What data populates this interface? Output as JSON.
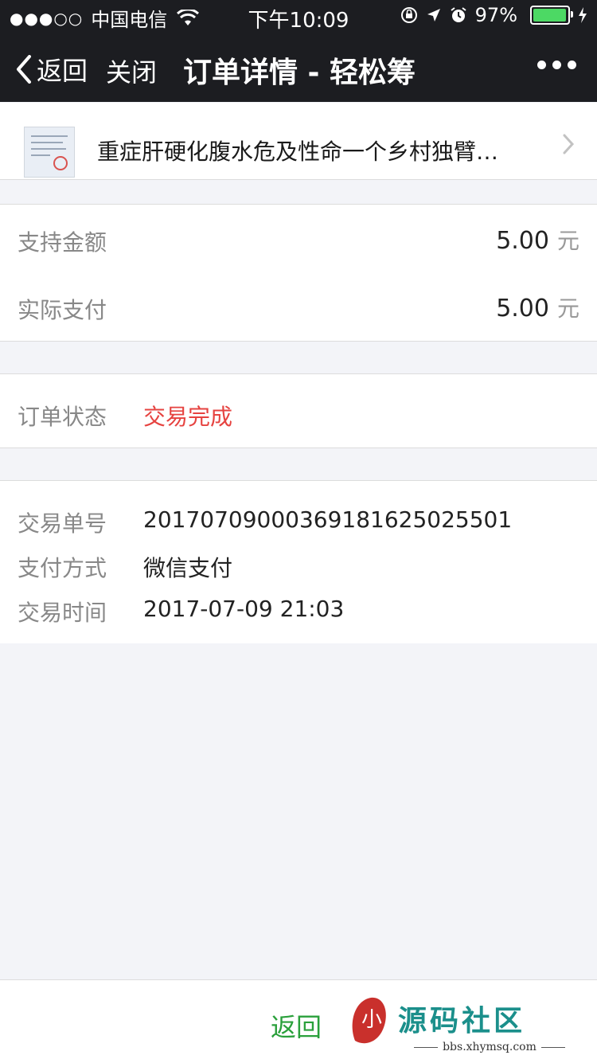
{
  "status_bar": {
    "signal": "●●●○○",
    "carrier": "中国电信",
    "time": "下午10:09",
    "battery": "97%",
    "battery_level": 0.97
  },
  "nav": {
    "back_label": "返回",
    "close_label": "关闭",
    "title": "订单详情 - 轻松筹"
  },
  "project": {
    "title": "重症肝硬化腹水危及性命一个乡村独臂…"
  },
  "amounts": {
    "support_label": "支持金额",
    "support_value": "5.00",
    "actual_label": "实际支付",
    "actual_value": "5.00",
    "unit": "元"
  },
  "order_status": {
    "label": "订单状态",
    "value": "交易完成",
    "value_color": "#e64340"
  },
  "transaction": {
    "number_label": "交易单号",
    "number_value": "20170709000369181625025501",
    "method_label": "支付方式",
    "method_value": "微信支付",
    "time_label": "交易时间",
    "time_value": "2017-07-09 21:03"
  },
  "bottom": {
    "return_label": "返回",
    "return_color": "#2aa03b"
  },
  "watermark": {
    "logo_text": "小",
    "text": "源码社区",
    "url": "bbs.xhymsq.com"
  }
}
